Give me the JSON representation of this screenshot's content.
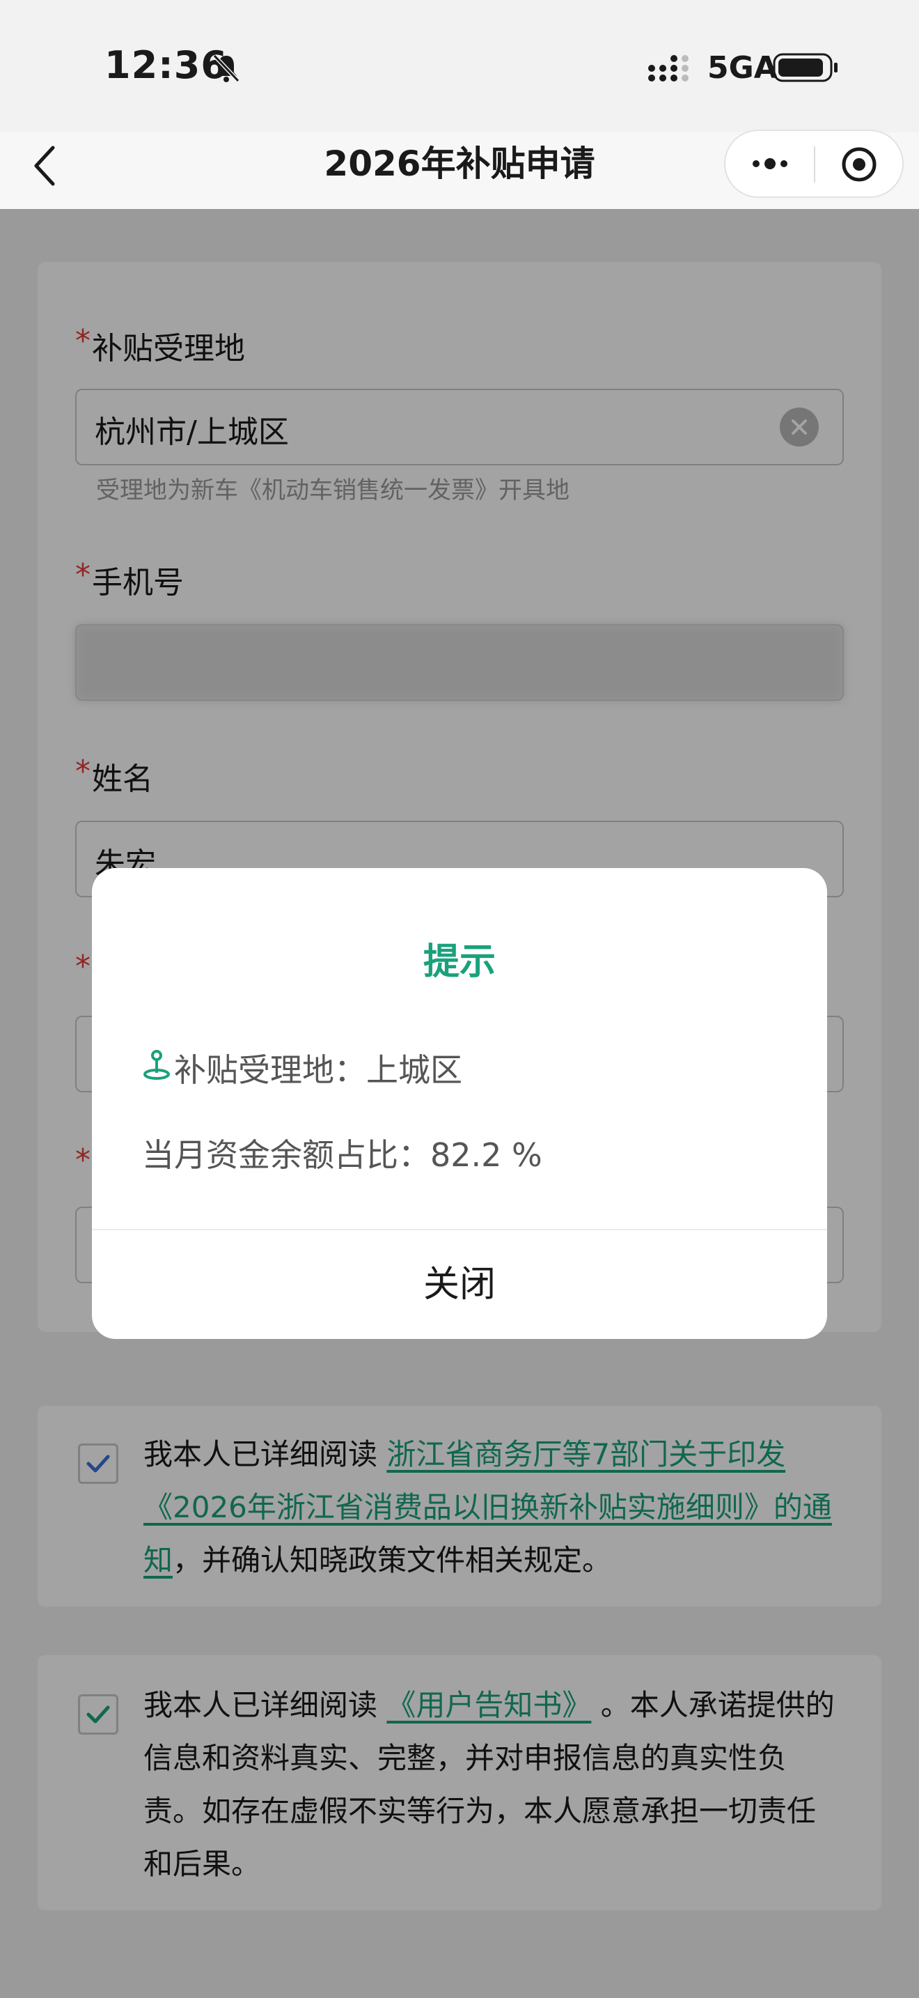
{
  "status_bar": {
    "time": "12:36",
    "network": "5GA"
  },
  "nav": {
    "title": "2026年补贴申请"
  },
  "form": {
    "location": {
      "required_mark": "*",
      "label": "补贴受理地",
      "value": "杭州市/上城区",
      "hint": "受理地为新车《机动车销售统一发票》开具地"
    },
    "phone": {
      "required_mark": "*",
      "label": "手机号"
    },
    "name": {
      "required_mark": "*",
      "label": "姓名",
      "value": "朱宏"
    },
    "field4": {
      "required_mark": "*"
    },
    "field5": {
      "required_mark": "*"
    }
  },
  "agreement1": {
    "prefix": "我本人已详细阅读 ",
    "link": "浙江省商务厅等7部门关于印发《2026年浙江省消费品以旧换新补贴实施细则》的通知",
    "suffix": "，并确认知晓政策文件相关规定。"
  },
  "agreement2": {
    "prefix": "我本人已详细阅读 ",
    "link": "《用户告知书》",
    "suffix": " 。本人承诺提供的信息和资料真实、完整，并对申报信息的真实性负责。如存在虚假不实等行为，本人愿意承担一切责任和后果。"
  },
  "dialog": {
    "title": "提示",
    "location_label": "补贴受理地：",
    "location_value": "上城区",
    "ratio_label": "当月资金余额占比：",
    "ratio_value": "82.2 %",
    "close_label": "关闭"
  },
  "colors": {
    "accent": "#1aa17c",
    "required": "#e23b3b",
    "checkbox_blue": "#3b6fd8"
  }
}
